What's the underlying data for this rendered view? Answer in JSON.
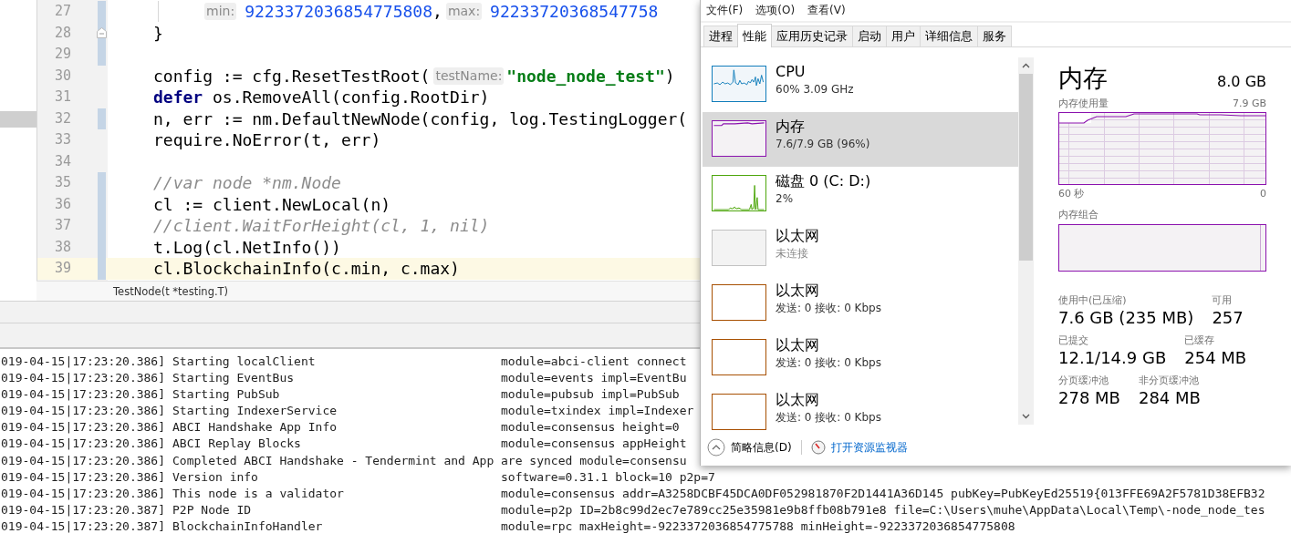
{
  "editor": {
    "lines": [
      {
        "number": "27",
        "changed": true,
        "current": false,
        "marked": false,
        "fold_marker": false,
        "tokens": [
          {
            "kind": "guide"
          },
          {
            "kind": "hint",
            "text": "min:"
          },
          {
            "kind": "number",
            "text": "9223372036854775808"
          },
          {
            "kind": "plain",
            "text": ","
          },
          {
            "kind": "hint",
            "text": "max:"
          },
          {
            "kind": "number",
            "text": "92233720368547758"
          }
        ]
      },
      {
        "number": "28",
        "changed": true,
        "current": false,
        "marked": false,
        "fold_marker": true,
        "tokens": [
          {
            "kind": "plain",
            "text": "}"
          }
        ]
      },
      {
        "number": "29",
        "changed": true,
        "current": false,
        "marked": false,
        "fold_marker": false
      },
      {
        "number": "30",
        "changed": false,
        "current": false,
        "marked": false,
        "fold_marker": false,
        "tokens": [
          {
            "kind": "plain",
            "text": "config := cfg.ResetTestRoot("
          },
          {
            "kind": "hint",
            "text": "testName:"
          },
          {
            "kind": "string",
            "text": "\"node_node_test\""
          },
          {
            "kind": "plain",
            "text": ")"
          }
        ]
      },
      {
        "number": "31",
        "changed": false,
        "current": false,
        "marked": false,
        "fold_marker": false,
        "tokens": [
          {
            "kind": "keyword",
            "text": "defer"
          },
          {
            "kind": "plain",
            "text": " os.RemoveAll(config.RootDir)"
          }
        ]
      },
      {
        "number": "32",
        "changed": true,
        "current": false,
        "marked": true,
        "fold_marker": false,
        "tokens": [
          {
            "kind": "plain",
            "text": "n, err := nm.DefaultNewNode(config, log.TestingLogger("
          }
        ]
      },
      {
        "number": "33",
        "changed": false,
        "current": false,
        "marked": false,
        "fold_marker": false,
        "tokens": [
          {
            "kind": "plain",
            "text": "require.NoError(t, err)"
          }
        ]
      },
      {
        "number": "34",
        "changed": false,
        "current": false,
        "marked": false,
        "fold_marker": false
      },
      {
        "number": "35",
        "changed": true,
        "current": false,
        "marked": false,
        "fold_marker": false,
        "tokens": [
          {
            "kind": "comment",
            "text": "//var node *nm.Node"
          }
        ]
      },
      {
        "number": "36",
        "changed": true,
        "current": false,
        "marked": false,
        "fold_marker": false,
        "tokens": [
          {
            "kind": "plain",
            "text": "cl := client.NewLocal(n)"
          }
        ]
      },
      {
        "number": "37",
        "changed": true,
        "current": false,
        "marked": false,
        "fold_marker": false,
        "tokens": [
          {
            "kind": "comment",
            "text": "//client.WaitForHeight(cl, 1, nil)"
          }
        ]
      },
      {
        "number": "38",
        "changed": true,
        "current": false,
        "marked": false,
        "fold_marker": false,
        "tokens": [
          {
            "kind": "plain",
            "text": "t.Log(cl.NetInfo())"
          }
        ]
      },
      {
        "number": "39",
        "changed": true,
        "current": true,
        "marked": false,
        "fold_marker": false,
        "tokens": [
          {
            "kind": "plain",
            "text": "cl.BlockchainInfo(c.min, c.max)"
          }
        ]
      }
    ],
    "breadcrumb": "TestNode(t *testing.T)"
  },
  "console": {
    "lines": [
      {
        "time": "019-04-15|17:23:20.386]",
        "message": "Starting localClient",
        "fields": "module=abci-client connect"
      },
      {
        "time": "019-04-15|17:23:20.386]",
        "message": "Starting EventBus",
        "fields": "module=events impl=EventBu"
      },
      {
        "time": "019-04-15|17:23:20.386]",
        "message": "Starting PubSub",
        "fields": "module=pubsub impl=PubSub"
      },
      {
        "time": "019-04-15|17:23:20.386]",
        "message": "Starting IndexerService",
        "fields": "module=txindex impl=Indexer"
      },
      {
        "time": "019-04-15|17:23:20.386]",
        "message": "ABCI Handshake App Info",
        "fields": "module=consensus height=0"
      },
      {
        "time": "019-04-15|17:23:20.386]",
        "message": "ABCI Replay Blocks",
        "fields": "module=consensus appHeight"
      },
      {
        "time": "019-04-15|17:23:20.386]",
        "message": "Completed ABCI Handshake - Tendermint and App are synced module=consensu"
      },
      {
        "time": "019-04-15|17:23:20.386]",
        "message": "Version info",
        "fields": "software=0.31.1 block=10 p2p=7"
      },
      {
        "time": "019-04-15|17:23:20.386]",
        "message": "This node is a validator",
        "fields": "module=consensus addr=A3258DCBF45DCA0DF052981870F2D1441A36D145 pubKey=PubKeyEd25519{013FFE69A2F5781D38EFB32"
      },
      {
        "time": "019-04-15|17:23:20.387]",
        "message": "P2P Node ID",
        "fields": "module=p2p ID=2b8c99d2ec7e789cc25e35981e9b8ffb08b791e8 file=C:\\Users\\muhe\\AppData\\Local\\Temp\\-node_node_tes"
      },
      {
        "time": "019-04-15|17:23:20.387]",
        "message": "BlockchainInfoHandler",
        "fields": "module=rpc maxHeight=-9223372036854775788 minHeight=-9223372036854775808"
      }
    ]
  },
  "task_manager": {
    "menu": [
      "文件(F)",
      "选项(O)",
      "查看(V)"
    ],
    "tabs": [
      {
        "label": "进程",
        "selected": false
      },
      {
        "label": "性能",
        "selected": true
      },
      {
        "label": "应用历史记录",
        "selected": false
      },
      {
        "label": "启动",
        "selected": false
      },
      {
        "label": "用户",
        "selected": false
      },
      {
        "label": "详细信息",
        "selected": false
      },
      {
        "label": "服务",
        "selected": false
      }
    ],
    "resources": [
      {
        "kind": "cpu",
        "title": "CPU",
        "detail": "60% 3.09 GHz",
        "color": "#117dbb",
        "selected": false
      },
      {
        "kind": "memory",
        "title": "内存",
        "detail": "7.6/7.9 GB (96%)",
        "color": "#8b12ae",
        "selected": true
      },
      {
        "kind": "disk",
        "title": "磁盘 0 (C: D:)",
        "detail": "2%",
        "color": "#4da60c",
        "selected": false
      },
      {
        "kind": "offline",
        "title": "以太网",
        "detail": "未连接",
        "color": "#c2c2c2",
        "selected": false
      },
      {
        "kind": "ethernet",
        "title": "以太网",
        "detail": "发送: 0 接收: 0 Kbps",
        "color": "#a74f01",
        "selected": false
      },
      {
        "kind": "ethernet",
        "title": "以太网",
        "detail": "发送: 0 接收: 0 Kbps",
        "color": "#a74f01",
        "selected": false
      },
      {
        "kind": "ethernet",
        "title": "以太网",
        "detail": "发送: 0 接收: 0 Kbps",
        "color": "#a74f01",
        "selected": false
      }
    ],
    "detail": {
      "title": "内存",
      "total": "8.0 GB",
      "usage_label": "内存使用量",
      "usage_max": "7.9 GB",
      "axis_start": "60 秒",
      "axis_end": "0",
      "composition_label": "内存组合",
      "stats": [
        [
          {
            "label": "使用中(已压缩)",
            "value": "7.6 GB (235 MB)"
          },
          {
            "label": "可用",
            "value": "257"
          }
        ],
        [
          {
            "label": "已提交",
            "value": "12.1/14.9 GB"
          },
          {
            "label": "已缓存",
            "value": "254 MB"
          }
        ],
        [
          {
            "label": "分页缓冲池",
            "value": "278 MB"
          },
          {
            "label": "非分页缓冲池",
            "value": "284 MB"
          }
        ]
      ]
    },
    "footer": {
      "summary": "简略信息(D)",
      "monitor_link": "打开资源监视器"
    }
  }
}
